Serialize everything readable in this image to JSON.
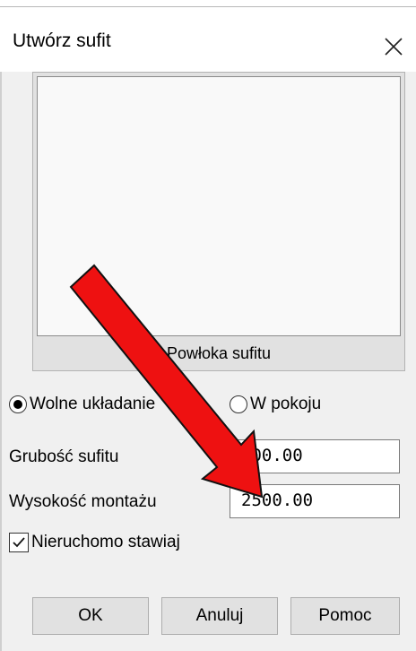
{
  "dialog": {
    "title": "Utwórz sufit"
  },
  "preview": {
    "label": "Powłoka sufitu"
  },
  "placement": {
    "options": [
      {
        "label": "Wolne układanie",
        "selected": true
      },
      {
        "label": "W pokoju",
        "selected": false
      }
    ]
  },
  "fields": {
    "thickness": {
      "label": "Grubość sufitu",
      "value": "100.00"
    },
    "mount_height": {
      "label": "Wysokość montażu",
      "value": "2500.00"
    }
  },
  "fixed_option": {
    "label": "Nieruchomo stawiaj",
    "checked": true
  },
  "buttons": {
    "ok": "OK",
    "cancel": "Anuluj",
    "help": "Pomoc"
  },
  "annotation": {
    "arrow_color": "#ee1111",
    "arrow_stroke": "#111111"
  }
}
